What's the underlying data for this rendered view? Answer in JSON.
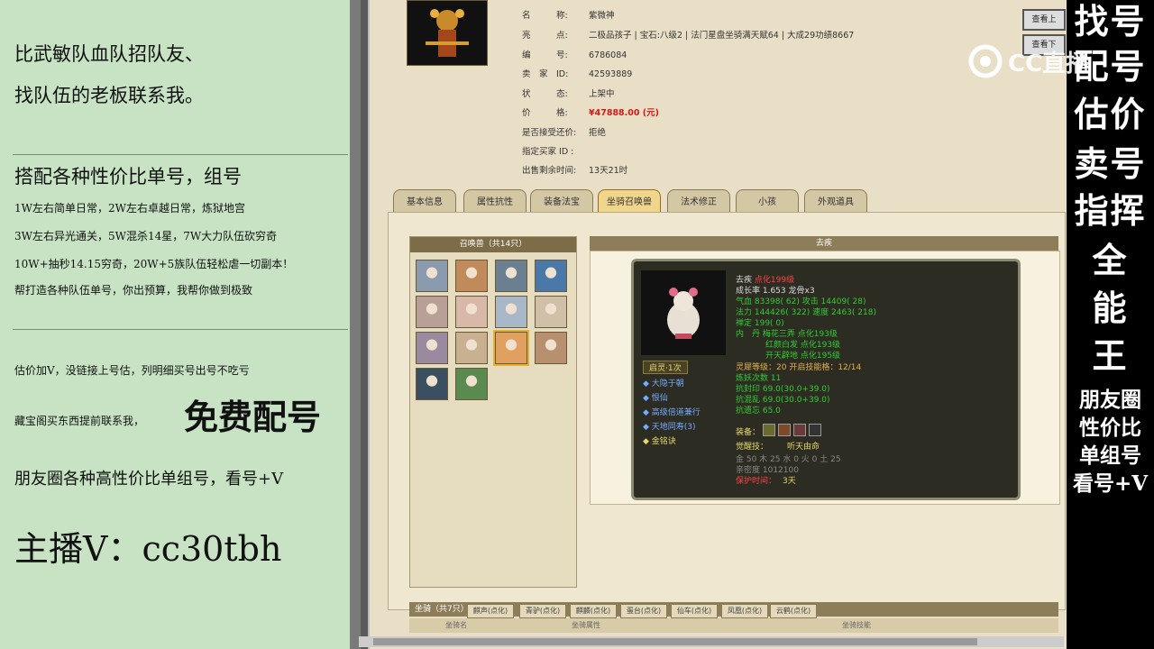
{
  "left": {
    "l1": "比武敏队血队招队友、",
    "l2": "找队伍的老板联系我。",
    "l3": "搭配各种性价比单号，组号",
    "l4": "1W左右简单日常，2W左右卓越日常，炼狱地宫",
    "l5": "3W左右异光通关，5W混杀14星，7W大力队伍砍穷奇",
    "l6": "10W+抽秒14.15穷奇，20W+5族队伍轻松虐一切副本！",
    "l7": "帮打造各种队伍单号，你出预算，我帮你做到极致",
    "l8": "估价加V，没链接上号估，列明细买号出号不吃亏",
    "l9a": "藏宝阁买东西提前联系我，",
    "l9b": "免费配号",
    "l10": "朋友圈各种高性价比单组号，看号+V",
    "l11": "主播V：cc30tbh"
  },
  "right": {
    "big": [
      "找号",
      "配号",
      "估价",
      "卖号",
      "指挥",
      "全",
      "能",
      "王"
    ],
    "small": [
      "朋友圈",
      "性价比",
      "单组号",
      "看号+V"
    ],
    "watermark": "CC直播"
  },
  "info": {
    "rows": [
      {
        "k": "名　　　称:",
        "v": "紫微神"
      },
      {
        "k": "亮　　　点:",
        "v": "二极品孩子 | 宝石:八级2 | 法门星盘坐骑满天赋64 | 大成29功绩8667"
      },
      {
        "k": "编　　　号:",
        "v": "6786084"
      },
      {
        "k": "卖　家　ID:",
        "v": "42593889"
      },
      {
        "k": "状　　　态:",
        "v": "上架中"
      },
      {
        "k": "价　　　格:",
        "v": "¥47888.00 (元)"
      },
      {
        "k": "是否接受还价:",
        "v": "拒绝"
      },
      {
        "k": "指定买家 ID :",
        "v": ""
      },
      {
        "k": "出售剩余时间:",
        "v": "13天21时"
      }
    ],
    "btn1": "查看上",
    "btn2": "查看下"
  },
  "tabs": [
    "基本信息",
    "属性抗性",
    "装备法宝",
    "坐骑召唤兽",
    "法术修正",
    "小孩",
    "外观道具"
  ],
  "summon_list_title": "召唤兽（共14只）",
  "detail_title": "去疾",
  "card": {
    "name": "去疾",
    "tag": "点化199级",
    "growth": "成长率 1.653 龙骨x3",
    "hp": "气血 83398( 62) 攻击 14409( 28)",
    "mp": "法力 144426( 322) 速度 2463( 218)",
    "zen": "禅定 199( 0)",
    "dan1": "内　丹 梅花三弄 点化193级",
    "dan2": "红颜白发 点化193级",
    "dan3": "开天辟地 点化195级",
    "spirit": "灵犀等级：20 开启技能格：12/14",
    "demon": "炼妖次数 11",
    "res1": "抗封印 69.0(30.0+39.0)",
    "res2": "抗混乱 69.0(30.0+39.0)",
    "res3": "抗遗忘 65.0",
    "equip": "装备：",
    "awaken": "觉醒技：",
    "awaken_skill": "听天由命",
    "elements": "金 50 木 25 水 0 火 0 土 25",
    "intimacy": "亲密度 1012100",
    "remain": "保护时间：",
    "remain_v": "3天",
    "rank": "启灵·1次",
    "skills": [
      "大隐于朝",
      "恨仙",
      "高级倍道兼行",
      "天地同寿(3)",
      "金铭诀"
    ]
  },
  "bottom": {
    "label": "坐骑（共7只）",
    "tabs": [
      "麒声(点化)",
      "青驴(点化)",
      "麒麟(点化)",
      "蛋台(点化)",
      "仙车(点化)",
      "凤凰(点化)",
      "云鹤(点化)"
    ],
    "col1": "坐骑名",
    "col2": "坐骑属性",
    "col3": "坐骑技能"
  }
}
